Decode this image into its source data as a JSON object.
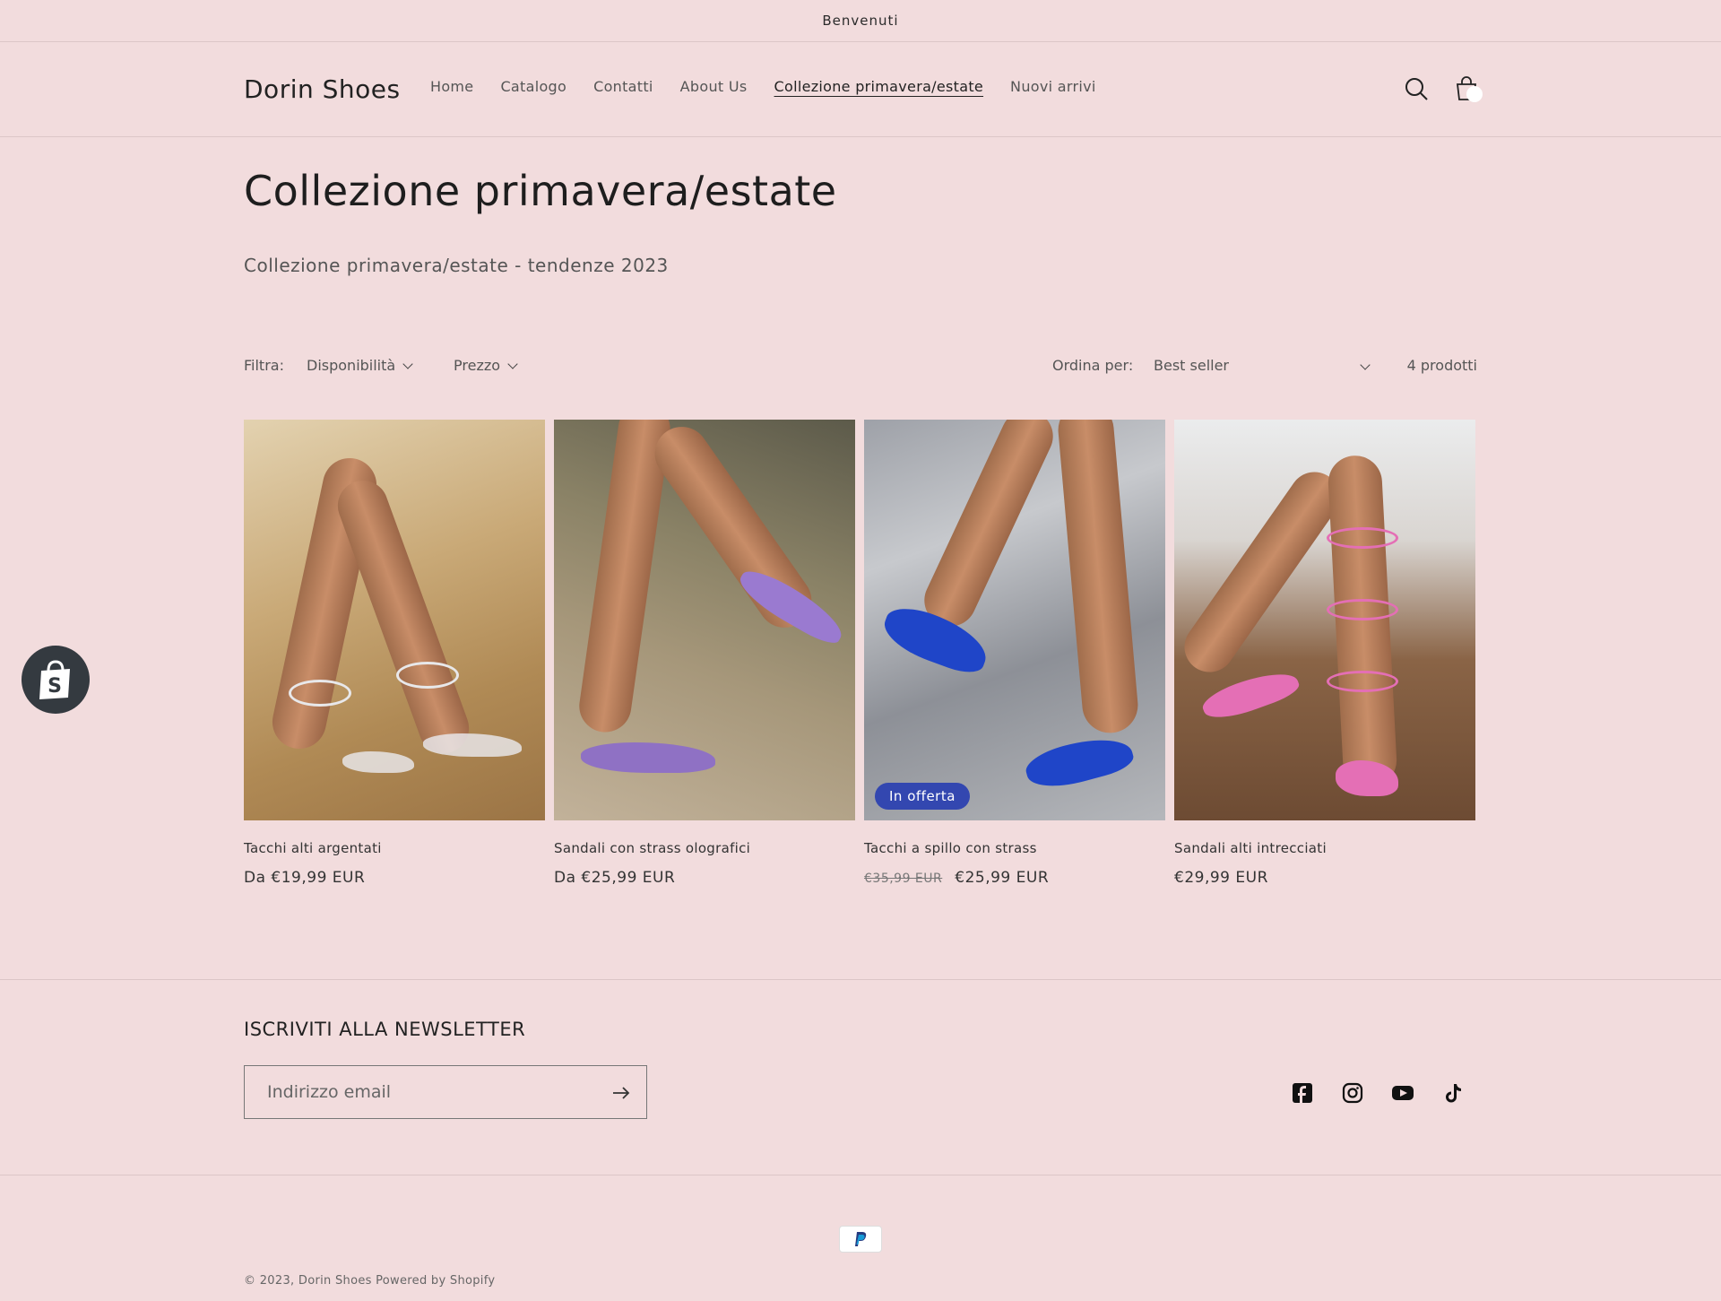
{
  "announcement": "Benvenuti",
  "header": {
    "logo": "Dorin Shoes",
    "nav": [
      "Home",
      "Catalogo",
      "Contatti",
      "About Us",
      "Collezione primavera/estate",
      "Nuovi arrivi"
    ],
    "active_nav": "Collezione primavera/estate"
  },
  "collection": {
    "title": "Collezione primavera/estate",
    "subtitle": "Collezione primavera/estate - tendenze 2023"
  },
  "filters": {
    "label": "Filtra:",
    "availability": "Disponibilità",
    "price": "Prezzo",
    "sort_label": "Ordina per:",
    "sort_value": "Best seller",
    "count": "4 prodotti"
  },
  "products": [
    {
      "title": "Tacchi alti argentati",
      "price": "Da €19,99 EUR"
    },
    {
      "title": "Sandali con strass olografici",
      "price": "Da €25,99 EUR"
    },
    {
      "title": "Tacchi a spillo con strass",
      "old_price": "€35,99 EUR",
      "price": "€25,99 EUR",
      "badge": "In offerta"
    },
    {
      "title": "Sandali alti intrecciati",
      "price": "€29,99 EUR"
    }
  ],
  "newsletter": {
    "title": "ISCRIVITI ALLA NEWSLETTER",
    "placeholder": "Indirizzo email"
  },
  "socials": [
    "facebook-icon",
    "instagram-icon",
    "youtube-icon",
    "tiktok-icon"
  ],
  "footer": {
    "copyright": "© 2023, Dorin Shoes Powered by Shopify"
  },
  "colors": {
    "background": "#f2dcdd",
    "badge": "#3347b0",
    "text": "#222222"
  }
}
